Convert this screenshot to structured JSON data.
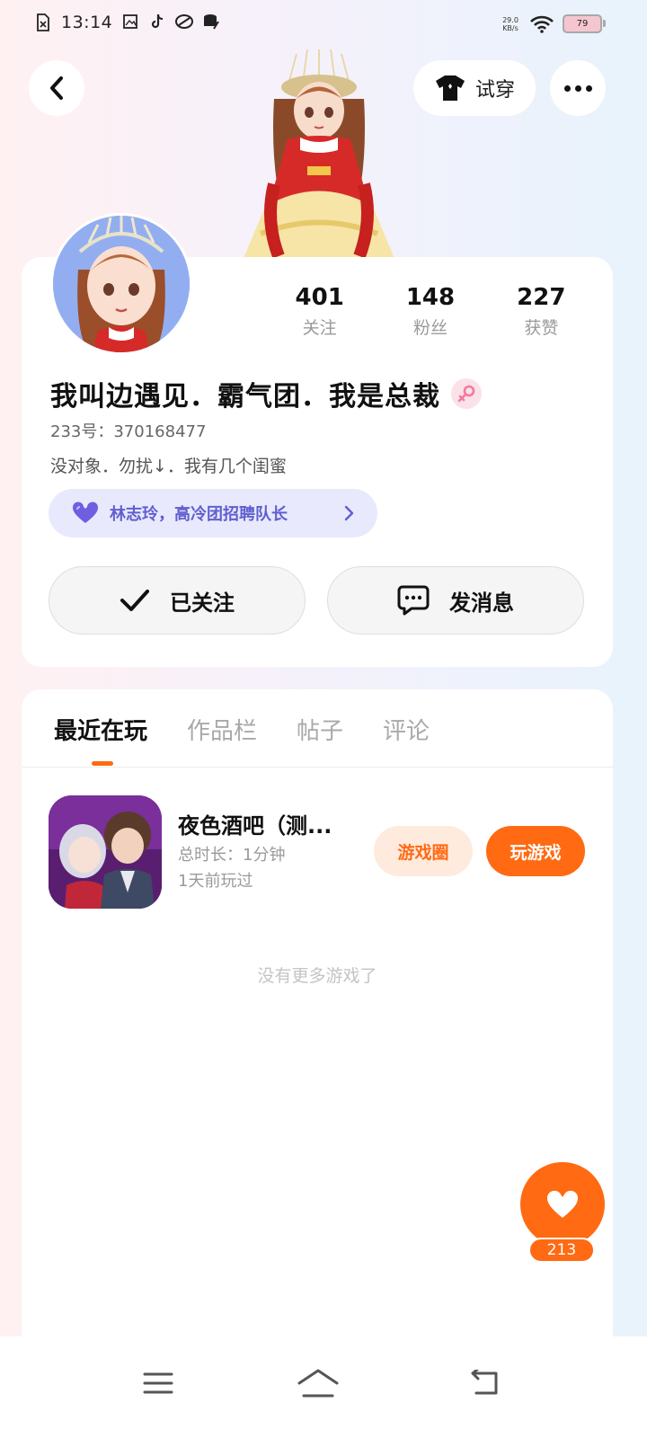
{
  "status_bar": {
    "time": "13:14",
    "net_speed_value": "29.0",
    "net_speed_unit": "KB/s",
    "battery_level": "79"
  },
  "header": {
    "try_on_label": "试穿"
  },
  "profile": {
    "stats": [
      {
        "value": "401",
        "label": "关注"
      },
      {
        "value": "148",
        "label": "粉丝"
      },
      {
        "value": "227",
        "label": "获赞"
      }
    ],
    "nickname": "我叫边遇见．霸气团．我是总裁",
    "gender": "female",
    "uid_text": "233号：370168477",
    "bio": "没对象．勿扰↓．我有几个闺蜜",
    "group_badge": "林志玲，高冷团招聘队长",
    "follow_label": "已关注",
    "message_label": "发消息"
  },
  "tabs": [
    "最近在玩",
    "作品栏",
    "帖子",
    "评论"
  ],
  "active_tab": 0,
  "game": {
    "title": "夜色酒吧（测...",
    "duration": "总时长：1分钟",
    "last_played": "1天前玩过",
    "circle_label": "游戏圈",
    "play_label": "玩游戏"
  },
  "no_more_text": "没有更多游戏了",
  "likes": {
    "count": "213"
  },
  "colors": {
    "accent": "#ff6a12",
    "accent_light": "#ffeade",
    "group_badge_bg": "#e9e9fd",
    "group_badge_text": "#5f5fcf"
  }
}
